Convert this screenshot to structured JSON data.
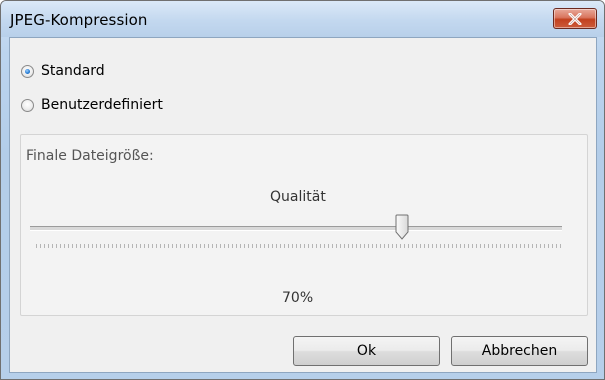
{
  "window": {
    "title": "JPEG-Kompression"
  },
  "options": {
    "standard_label": "Standard",
    "custom_label": "Benutzerdefiniert",
    "selected": "standard"
  },
  "file_size": {
    "label": "Finale Dateigröße:"
  },
  "quality": {
    "label": "Qualität",
    "value": 70,
    "value_label": "70%"
  },
  "buttons": {
    "ok": "Ok",
    "cancel": "Abbrechen"
  },
  "colors": {
    "close_button": "#c7472a",
    "accent": "#2a7fd6"
  },
  "icons": {
    "close": "close-icon",
    "radio": "radio-icon"
  }
}
